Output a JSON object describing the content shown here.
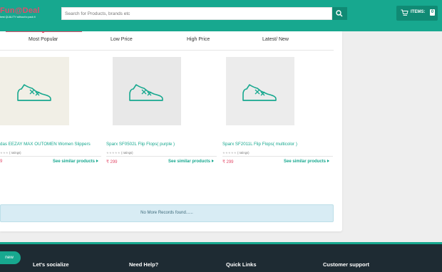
{
  "header": {
    "logo_text": "Fun@Deal",
    "logo_tagline": "best QUALITY without to pack it",
    "search_placeholder": "Search for Products, brands etc",
    "cart_label": "ITEMS:",
    "cart_count": "0"
  },
  "sort_tabs": [
    {
      "label": "Most Popular",
      "active": true
    },
    {
      "label": "Low Price",
      "active": false
    },
    {
      "label": "High Price",
      "active": false
    },
    {
      "label": "Latest/ New",
      "active": false
    }
  ],
  "products": [
    {
      "name": "das EEZAY MAX OUTOMEN Women Slippers",
      "rating_text": "( ratings)",
      "price": "9",
      "similar_label": "See similar products"
    },
    {
      "name": "Sparx SF0502L Flip Flops( purple )",
      "rating_text": "( ratings)",
      "price": "₹ 299",
      "similar_label": "See similar products"
    },
    {
      "name": "Sparx SF2011L Flip Flops( multicolor )",
      "rating_text": "( ratings)",
      "price": "₹ 299",
      "similar_label": "See similar products"
    }
  ],
  "no_more_text": "No More Records found......",
  "footer": {
    "badge": "new",
    "sections": [
      "Let's socialize",
      "Need Help?",
      "Quick Links",
      "Customer support"
    ]
  },
  "colors": {
    "brand": "#17a88f",
    "accent": "#e34b6a",
    "footer_bg": "#1e2b33"
  }
}
